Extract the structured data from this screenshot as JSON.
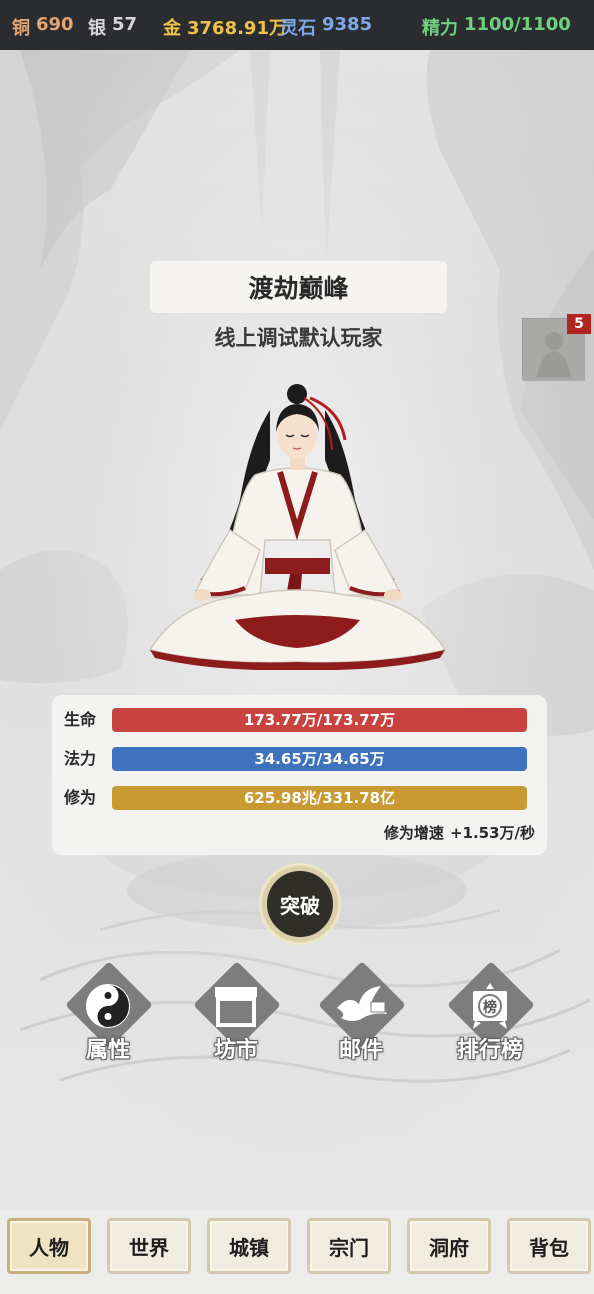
{
  "resources": {
    "copper": {
      "label": "铜",
      "value": "690",
      "color": "#e0a574"
    },
    "silver": {
      "label": "银",
      "value": "57",
      "color": "#d6d6d6"
    },
    "gold": {
      "label": "金",
      "value": "3768.91万",
      "color": "#f0c24b"
    },
    "spirit_stone": {
      "label": "灵石",
      "value": "9385",
      "color": "#7fa8e8"
    },
    "energy": {
      "label": "精力",
      "value": "1100/1100",
      "color": "#6fd07f"
    }
  },
  "realm": "渡劫巅峰",
  "player_name": "线上调试默认玩家",
  "side_badge": "5",
  "stats": {
    "hp": {
      "label": "生命",
      "text": "173.77万/173.77万",
      "fill": 1.0,
      "color": "#c8423f"
    },
    "mp": {
      "label": "法力",
      "text": "34.65万/34.65万",
      "fill": 1.0,
      "color": "#3e72bd"
    },
    "cultivation": {
      "label": "修为",
      "text": "625.98兆/331.78亿",
      "fill": 1.0,
      "color": "#c99a32"
    },
    "speed_label": "修为增速",
    "speed_value": "+1.53万/秒"
  },
  "breakthrough_label": "突破",
  "functions": [
    {
      "label": "属性",
      "icon": "yin-yang-icon"
    },
    {
      "label": "坊市",
      "icon": "market-stall-icon"
    },
    {
      "label": "邮件",
      "icon": "dove-icon"
    },
    {
      "label": "排行榜",
      "icon": "ranking-banner-icon"
    }
  ],
  "ranking_icon_text": "榜",
  "tabs": [
    {
      "label": "人物",
      "active": true
    },
    {
      "label": "世界",
      "active": false
    },
    {
      "label": "城镇",
      "active": false
    },
    {
      "label": "宗门",
      "active": false
    },
    {
      "label": "洞府",
      "active": false
    },
    {
      "label": "背包",
      "active": false
    }
  ]
}
